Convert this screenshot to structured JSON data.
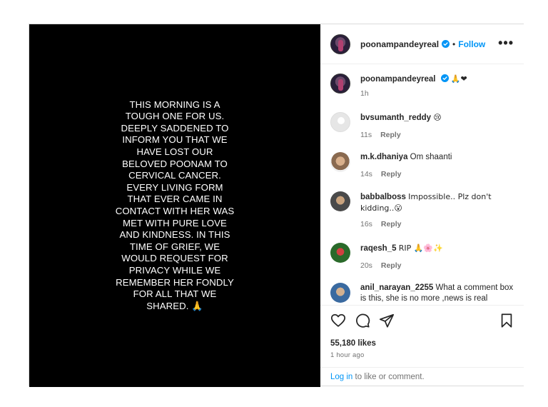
{
  "media": {
    "lines": [
      "THIS MORNING IS A",
      "TOUGH ONE FOR US.",
      "DEEPLY SADDENED TO",
      "INFORM YOU THAT WE",
      "HAVE LOST OUR",
      "BELOVED POONAM TO",
      "CERVICAL CANCER.",
      "EVERY LIVING FORM",
      "THAT EVER CAME IN",
      "CONTACT WITH HER WAS",
      "MET WITH PURE LOVE",
      "AND KINDNESS. IN THIS",
      "TIME OF GRIEF, WE",
      "WOULD REQUEST FOR",
      "PRIVACY WHILE WE",
      "REMEMBER HER FONDLY",
      "FOR ALL THAT WE",
      "SHARED. 🙏"
    ]
  },
  "header": {
    "username": "poonampandeyreal",
    "separator": "•",
    "follow_label": "Follow",
    "more_label": "•••"
  },
  "caption": {
    "username": "poonampandeyreal",
    "text": "🙏❤",
    "time": "1h"
  },
  "comments": [
    {
      "username": "bvsumanth_reddy",
      "text": "😢",
      "time": "11s",
      "reply": "Reply"
    },
    {
      "username": "m.k.dhaniya",
      "text": "Om shaanti",
      "time": "14s",
      "reply": "Reply"
    },
    {
      "username": "babbalboss",
      "text": "Impossible.. Plz don't kidding..😮",
      "time": "16s",
      "reply": "Reply"
    },
    {
      "username": "raqesh_5",
      "text": "RIP 🙏🌸✨",
      "time": "20s",
      "reply": "Reply"
    },
    {
      "username": "anil_narayan_2255",
      "text": "What a comment box is this, she is no more ,news is real",
      "time": "",
      "reply": ""
    }
  ],
  "footer": {
    "likes": "55,180 likes",
    "time": "1 hour ago",
    "login_link": "Log in",
    "login_rest": " to like or comment."
  },
  "icons": {
    "like": "heart-icon",
    "comment": "comment-icon",
    "share": "share-icon",
    "save": "bookmark-icon",
    "verified": "verified-badge-icon"
  },
  "colors": {
    "accent": "#0095f6",
    "verified": "#0095f6",
    "media_bg": "#000000",
    "muted": "#737373"
  }
}
